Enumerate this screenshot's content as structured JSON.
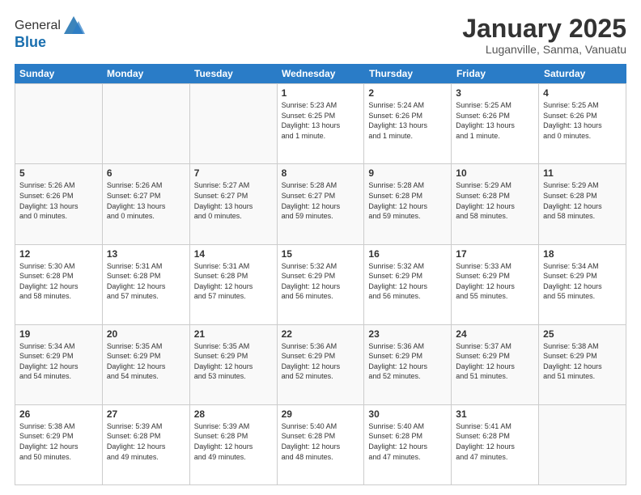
{
  "header": {
    "logo_line1": "General",
    "logo_line2": "Blue",
    "month_title": "January 2025",
    "location": "Luganville, Sanma, Vanuatu"
  },
  "days_of_week": [
    "Sunday",
    "Monday",
    "Tuesday",
    "Wednesday",
    "Thursday",
    "Friday",
    "Saturday"
  ],
  "weeks": [
    [
      {
        "day": "",
        "info": ""
      },
      {
        "day": "",
        "info": ""
      },
      {
        "day": "",
        "info": ""
      },
      {
        "day": "1",
        "info": "Sunrise: 5:23 AM\nSunset: 6:25 PM\nDaylight: 13 hours\nand 1 minute."
      },
      {
        "day": "2",
        "info": "Sunrise: 5:24 AM\nSunset: 6:26 PM\nDaylight: 13 hours\nand 1 minute."
      },
      {
        "day": "3",
        "info": "Sunrise: 5:25 AM\nSunset: 6:26 PM\nDaylight: 13 hours\nand 1 minute."
      },
      {
        "day": "4",
        "info": "Sunrise: 5:25 AM\nSunset: 6:26 PM\nDaylight: 13 hours\nand 0 minutes."
      }
    ],
    [
      {
        "day": "5",
        "info": "Sunrise: 5:26 AM\nSunset: 6:26 PM\nDaylight: 13 hours\nand 0 minutes."
      },
      {
        "day": "6",
        "info": "Sunrise: 5:26 AM\nSunset: 6:27 PM\nDaylight: 13 hours\nand 0 minutes."
      },
      {
        "day": "7",
        "info": "Sunrise: 5:27 AM\nSunset: 6:27 PM\nDaylight: 13 hours\nand 0 minutes."
      },
      {
        "day": "8",
        "info": "Sunrise: 5:28 AM\nSunset: 6:27 PM\nDaylight: 12 hours\nand 59 minutes."
      },
      {
        "day": "9",
        "info": "Sunrise: 5:28 AM\nSunset: 6:28 PM\nDaylight: 12 hours\nand 59 minutes."
      },
      {
        "day": "10",
        "info": "Sunrise: 5:29 AM\nSunset: 6:28 PM\nDaylight: 12 hours\nand 58 minutes."
      },
      {
        "day": "11",
        "info": "Sunrise: 5:29 AM\nSunset: 6:28 PM\nDaylight: 12 hours\nand 58 minutes."
      }
    ],
    [
      {
        "day": "12",
        "info": "Sunrise: 5:30 AM\nSunset: 6:28 PM\nDaylight: 12 hours\nand 58 minutes."
      },
      {
        "day": "13",
        "info": "Sunrise: 5:31 AM\nSunset: 6:28 PM\nDaylight: 12 hours\nand 57 minutes."
      },
      {
        "day": "14",
        "info": "Sunrise: 5:31 AM\nSunset: 6:28 PM\nDaylight: 12 hours\nand 57 minutes."
      },
      {
        "day": "15",
        "info": "Sunrise: 5:32 AM\nSunset: 6:29 PM\nDaylight: 12 hours\nand 56 minutes."
      },
      {
        "day": "16",
        "info": "Sunrise: 5:32 AM\nSunset: 6:29 PM\nDaylight: 12 hours\nand 56 minutes."
      },
      {
        "day": "17",
        "info": "Sunrise: 5:33 AM\nSunset: 6:29 PM\nDaylight: 12 hours\nand 55 minutes."
      },
      {
        "day": "18",
        "info": "Sunrise: 5:34 AM\nSunset: 6:29 PM\nDaylight: 12 hours\nand 55 minutes."
      }
    ],
    [
      {
        "day": "19",
        "info": "Sunrise: 5:34 AM\nSunset: 6:29 PM\nDaylight: 12 hours\nand 54 minutes."
      },
      {
        "day": "20",
        "info": "Sunrise: 5:35 AM\nSunset: 6:29 PM\nDaylight: 12 hours\nand 54 minutes."
      },
      {
        "day": "21",
        "info": "Sunrise: 5:35 AM\nSunset: 6:29 PM\nDaylight: 12 hours\nand 53 minutes."
      },
      {
        "day": "22",
        "info": "Sunrise: 5:36 AM\nSunset: 6:29 PM\nDaylight: 12 hours\nand 52 minutes."
      },
      {
        "day": "23",
        "info": "Sunrise: 5:36 AM\nSunset: 6:29 PM\nDaylight: 12 hours\nand 52 minutes."
      },
      {
        "day": "24",
        "info": "Sunrise: 5:37 AM\nSunset: 6:29 PM\nDaylight: 12 hours\nand 51 minutes."
      },
      {
        "day": "25",
        "info": "Sunrise: 5:38 AM\nSunset: 6:29 PM\nDaylight: 12 hours\nand 51 minutes."
      }
    ],
    [
      {
        "day": "26",
        "info": "Sunrise: 5:38 AM\nSunset: 6:29 PM\nDaylight: 12 hours\nand 50 minutes."
      },
      {
        "day": "27",
        "info": "Sunrise: 5:39 AM\nSunset: 6:28 PM\nDaylight: 12 hours\nand 49 minutes."
      },
      {
        "day": "28",
        "info": "Sunrise: 5:39 AM\nSunset: 6:28 PM\nDaylight: 12 hours\nand 49 minutes."
      },
      {
        "day": "29",
        "info": "Sunrise: 5:40 AM\nSunset: 6:28 PM\nDaylight: 12 hours\nand 48 minutes."
      },
      {
        "day": "30",
        "info": "Sunrise: 5:40 AM\nSunset: 6:28 PM\nDaylight: 12 hours\nand 47 minutes."
      },
      {
        "day": "31",
        "info": "Sunrise: 5:41 AM\nSunset: 6:28 PM\nDaylight: 12 hours\nand 47 minutes."
      },
      {
        "day": "",
        "info": ""
      }
    ]
  ]
}
